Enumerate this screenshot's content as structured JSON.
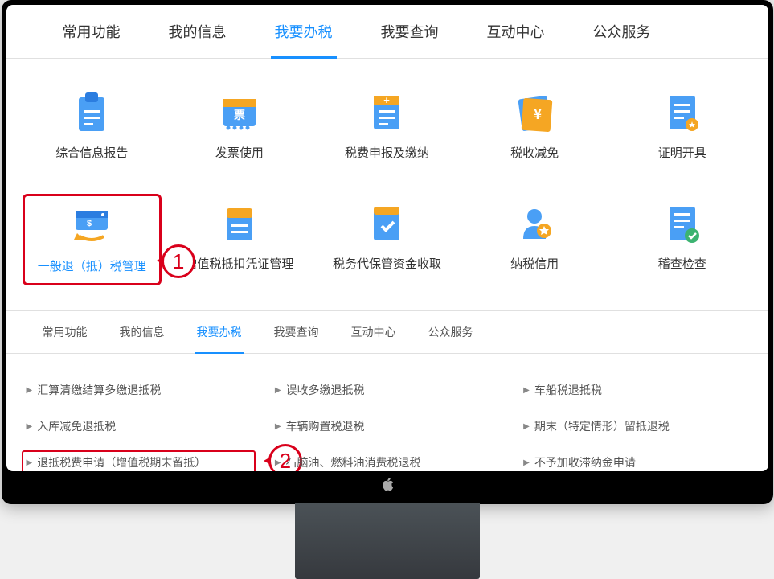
{
  "main_tabs": [
    "常用功能",
    "我的信息",
    "我要办税",
    "我要查询",
    "互动中心",
    "公众服务"
  ],
  "main_tabs_active": 2,
  "grid": [
    {
      "label": "综合信息报告"
    },
    {
      "label": "发票使用"
    },
    {
      "label": "税费申报及缴纳"
    },
    {
      "label": "税收减免"
    },
    {
      "label": "证明开具"
    },
    {
      "label": "一般退（抵）税管理",
      "highlighted": true,
      "badge": "1"
    },
    {
      "label": "增值税抵扣凭证管理"
    },
    {
      "label": "税务代保管资金收取"
    },
    {
      "label": "纳税信用"
    },
    {
      "label": "稽查检查"
    }
  ],
  "sub_tabs": [
    "常用功能",
    "我的信息",
    "我要办税",
    "我要查询",
    "互动中心",
    "公众服务"
  ],
  "sub_tabs_active": 2,
  "links": [
    {
      "label": "汇算清缴结算多缴退抵税"
    },
    {
      "label": "误收多缴退抵税"
    },
    {
      "label": "车船税退抵税"
    },
    {
      "label": "入库减免退抵税"
    },
    {
      "label": "车辆购置税退税"
    },
    {
      "label": "期末（特定情形）留抵退税"
    },
    {
      "label": "退抵税费申请（增值税期末留抵）",
      "highlighted": true,
      "badge": "2"
    },
    {
      "label": "石脑油、燃料油消费税退税"
    },
    {
      "label": "不予加收滞纳金申请"
    }
  ]
}
